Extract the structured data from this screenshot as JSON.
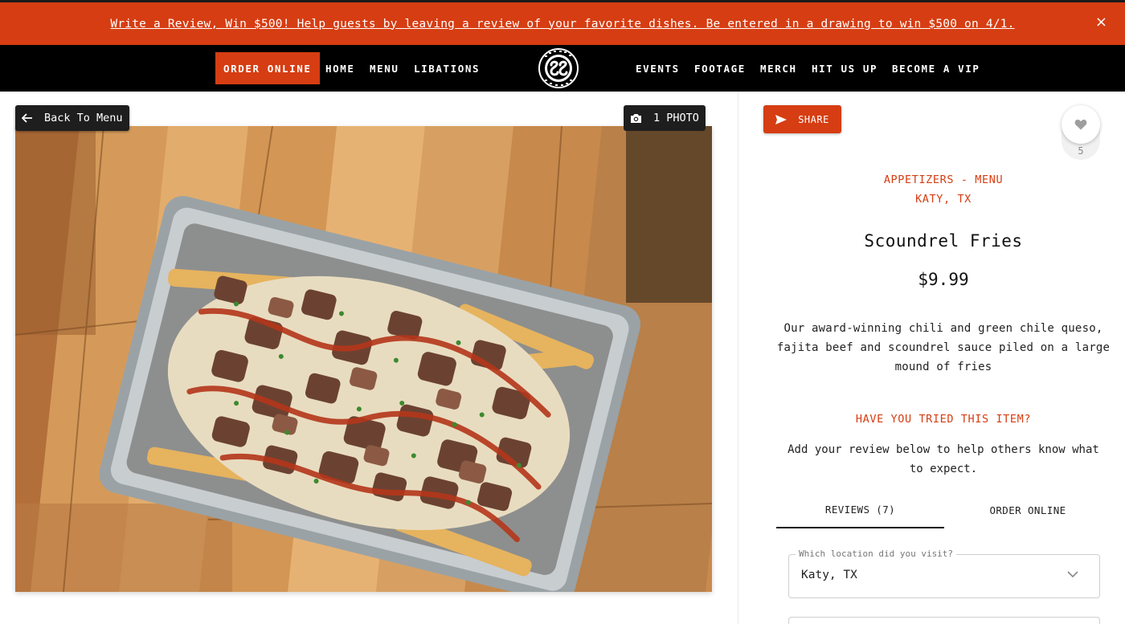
{
  "banner": {
    "text": "Write a Review, Win $500! Help guests by leaving a review of your favorite dishes. Be entered in a drawing to win $500 on 4/1.",
    "close": "×"
  },
  "nav": {
    "order_online": "ORDER ONLINE",
    "home": "HOME",
    "menu": "MENU",
    "libations": "LIBATIONS",
    "events": "EVENTS",
    "footage": "FOOTAGE",
    "merch": "MERCH",
    "hit_us_up": "HIT US UP",
    "become_vip": "BECOME A VIP"
  },
  "photo_panel": {
    "back_label": "Back To Menu",
    "photo_count_label": "1 PHOTO"
  },
  "item": {
    "share_label": "SHARE",
    "favorites_count": "5",
    "category": "APPETIZERS - MENU",
    "location": "KATY, TX",
    "name": "Scoundrel Fries",
    "price": "$9.99",
    "description": "Our award-winning chili and green chile queso, fajita beef and scoundrel sauce piled on a large mound of fries",
    "tried_prompt": "HAVE YOU TRIED THIS ITEM?",
    "review_prompt": "Add your review below to help others know what to expect."
  },
  "tabs": {
    "reviews": "REVIEWS (7)",
    "order_online": "ORDER ONLINE"
  },
  "location_select": {
    "legend": "Which location did you visit?",
    "value": "Katy, TX"
  },
  "colors": {
    "brand_orange": "#d63d12",
    "nav_black": "#000000"
  },
  "icons": {
    "back": "arrow-left-icon",
    "photo": "camera-icon",
    "share": "send-icon",
    "favorite": "heart-icon",
    "select": "chevron-down-icon",
    "close": "close-icon"
  }
}
